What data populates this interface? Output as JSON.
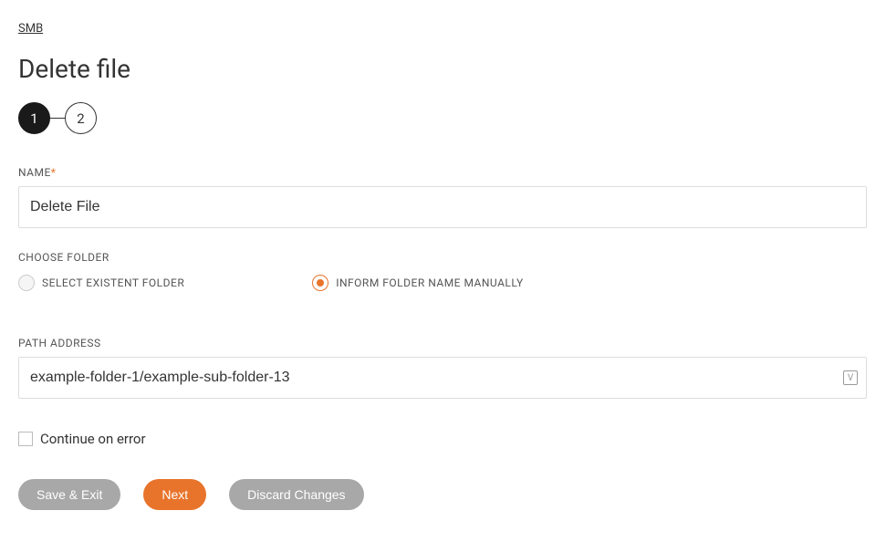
{
  "breadcrumb": "SMB",
  "page_title": "Delete file",
  "stepper": {
    "steps": [
      "1",
      "2"
    ],
    "active_index": 0
  },
  "form": {
    "name": {
      "label": "NAME",
      "required": true,
      "value": "Delete File"
    },
    "choose_folder": {
      "label": "CHOOSE FOLDER",
      "options": {
        "select_existent": "SELECT EXISTENT FOLDER",
        "inform_manually": "INFORM FOLDER NAME MANUALLY"
      },
      "selected": "inform_manually"
    },
    "path_address": {
      "label": "PATH ADDRESS",
      "value": "example-folder-1/example-sub-folder-13",
      "icon": "V"
    },
    "continue_on_error": {
      "label": "Continue on error",
      "checked": false
    }
  },
  "buttons": {
    "save_exit": "Save & Exit",
    "next": "Next",
    "discard": "Discard Changes"
  }
}
